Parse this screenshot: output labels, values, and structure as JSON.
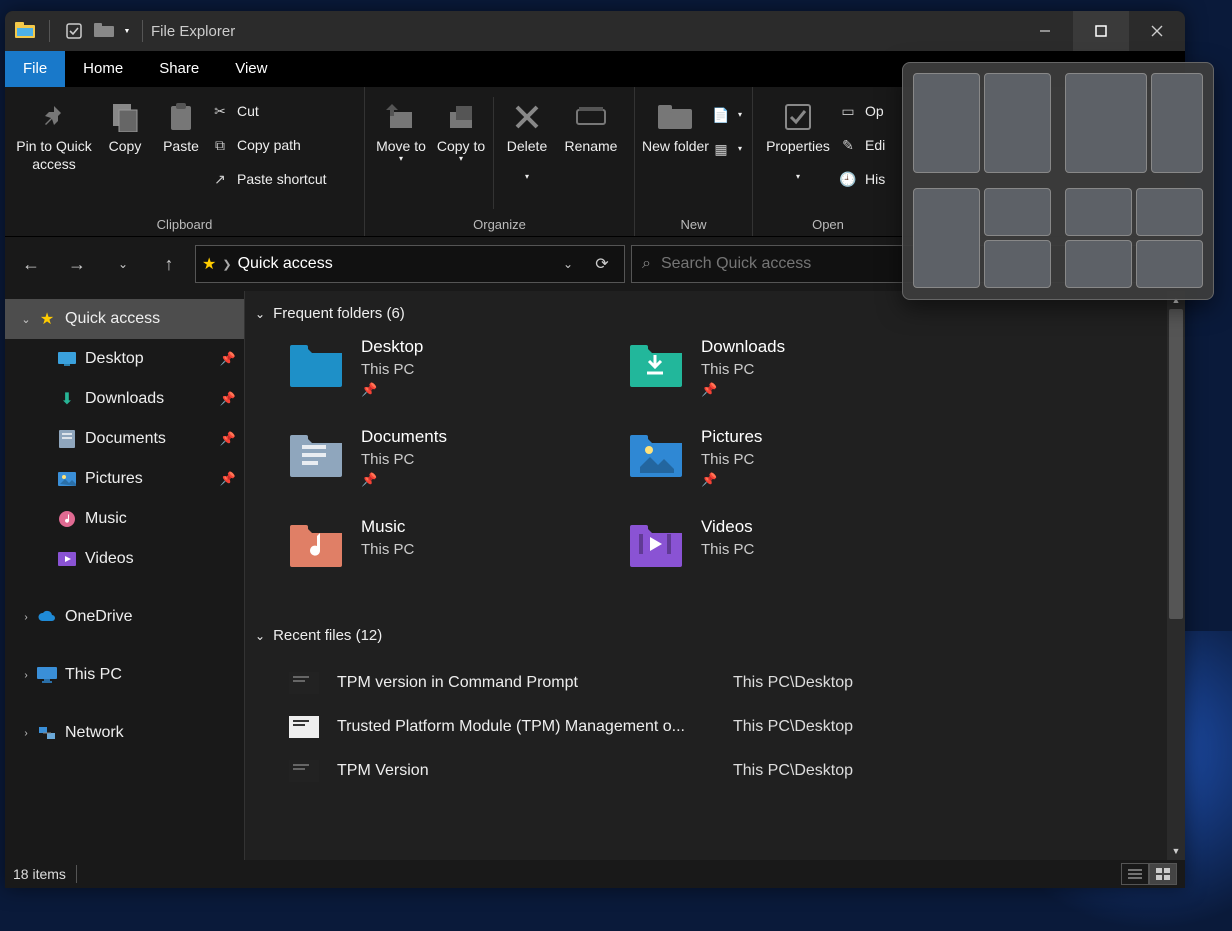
{
  "title": "File Explorer",
  "ribbon_tabs": {
    "file": "File",
    "home": "Home",
    "share": "Share",
    "view": "View"
  },
  "ribbon": {
    "clipboard": {
      "label": "Clipboard",
      "pin": "Pin to Quick access",
      "copy": "Copy",
      "paste": "Paste",
      "cut": "Cut",
      "copy_path": "Copy path",
      "paste_shortcut": "Paste shortcut"
    },
    "organize": {
      "label": "Organize",
      "move_to": "Move to",
      "copy_to": "Copy to",
      "delete": "Delete",
      "rename": "Rename"
    },
    "new_grp": {
      "label": "New",
      "new_folder": "New folder"
    },
    "open_grp": {
      "label": "Open",
      "properties": "Properties",
      "open": "Op",
      "edit": "Edi",
      "history": "His"
    }
  },
  "breadcrumb": "Quick access",
  "search": {
    "placeholder": "Search Quick access"
  },
  "tree": {
    "quick_access": "Quick access",
    "desktop": "Desktop",
    "downloads": "Downloads",
    "documents": "Documents",
    "pictures": "Pictures",
    "music": "Music",
    "videos": "Videos",
    "onedrive": "OneDrive",
    "this_pc": "This PC",
    "network": "Network"
  },
  "sections": {
    "frequent": "Frequent folders (6)",
    "recent": "Recent files (12)"
  },
  "frequent": [
    {
      "name": "Desktop",
      "sub": "This PC",
      "icon": "f-desktop",
      "pinned": true
    },
    {
      "name": "Downloads",
      "sub": "This PC",
      "icon": "f-downloads",
      "pinned": true
    },
    {
      "name": "Documents",
      "sub": "This PC",
      "icon": "f-documents",
      "pinned": true
    },
    {
      "name": "Pictures",
      "sub": "This PC",
      "icon": "f-pictures",
      "pinned": true
    },
    {
      "name": "Music",
      "sub": "This PC",
      "icon": "f-music",
      "pinned": false
    },
    {
      "name": "Videos",
      "sub": "This PC",
      "icon": "f-videos",
      "pinned": false
    }
  ],
  "recent": [
    {
      "name": "TPM version in Command Prompt",
      "path": "This PC\\Desktop",
      "icon": "dark"
    },
    {
      "name": "Trusted Platform Module (TPM) Management o...",
      "path": "This PC\\Desktop",
      "icon": "light"
    },
    {
      "name": "TPM Version",
      "path": "This PC\\Desktop",
      "icon": "dark"
    }
  ],
  "status": {
    "items": "18 items"
  }
}
